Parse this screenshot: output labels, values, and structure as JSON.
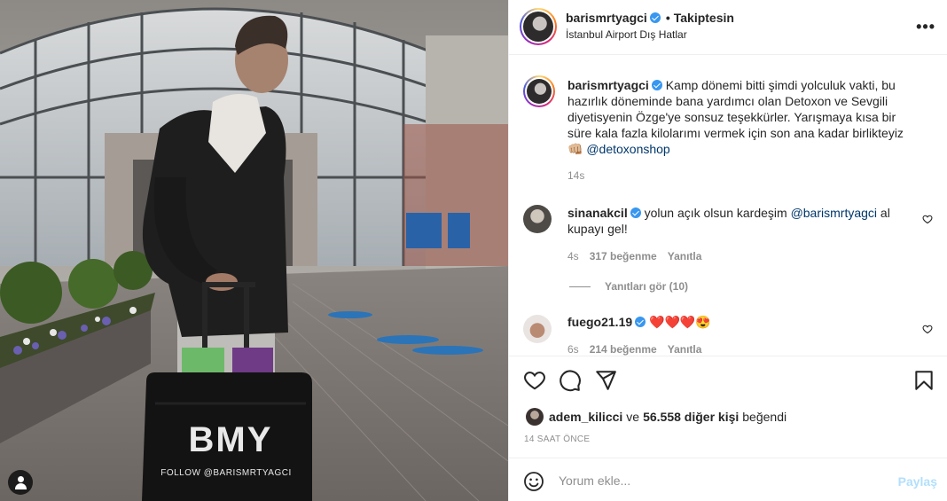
{
  "post": {
    "author": "barismrtyagci",
    "follow_status": "Takiptesin",
    "separator": "•",
    "location": "İstanbul Airport Dış Hatlar",
    "more_label": "•••"
  },
  "photo": {
    "luggage_brand": "BMY",
    "luggage_caption": "FOLLOW @BARISMRTYAGCI"
  },
  "caption": {
    "username": "barismrtyagci",
    "text": "Kamp dönemi bitti şimdi yolculuk vakti, bu hazırlık döneminde bana yardımcı olan Detoxon ve Sevgili diyetisyenin Özge'ye sonsuz teşekkürler. Yarışmaya kısa bir süre kala fazla kilolarımı vermek için son ana kadar birlikteyiz 👊🏼",
    "mention": "@detoxonshop",
    "time": "14s"
  },
  "comments": [
    {
      "username": "sinanakcil",
      "text_before": "yolun açık olsun kardeşim",
      "mention": "@barismrtyagci",
      "text_after": "al kupayı gel!",
      "time": "4s",
      "likes": "317 beğenme",
      "reply": "Yanıtla",
      "view_replies": "Yanıtları gör (10)"
    },
    {
      "username": "fuego21.19",
      "text": "❤️❤️❤️😍",
      "time": "6s",
      "likes": "214 beğenme",
      "reply": "Yanıtla"
    }
  ],
  "likes": {
    "liker": "adem_kilicci",
    "conjunction": "ve",
    "others": "56.558 diğer kişi",
    "suffix": "beğendi"
  },
  "time_ago": "14 SAAT ÖNCE",
  "comment_input": {
    "placeholder": "Yorum ekle...",
    "post_label": "Paylaş"
  },
  "colors": {
    "verified": "#3897f0",
    "link": "#00376b",
    "muted": "#8e8e8e",
    "post_disabled": "#b2dffc",
    "heart_red": "#ed4956"
  }
}
